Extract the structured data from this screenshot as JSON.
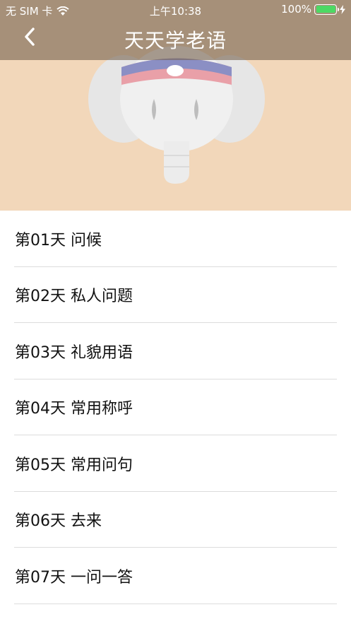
{
  "status_bar": {
    "carrier": "无 SIM 卡",
    "time": "上午10:38",
    "battery_percent": "100%",
    "battery_color": "#4cd964"
  },
  "nav": {
    "title": "天天学老语",
    "back_icon": "chevron-left-icon"
  },
  "hero": {
    "background_color": "#f2d7ba",
    "illustration": "elephant-icon"
  },
  "lessons": [
    {
      "label": "第01天 问候"
    },
    {
      "label": "第02天 私人问题"
    },
    {
      "label": "第03天 礼貌用语"
    },
    {
      "label": "第04天 常用称呼"
    },
    {
      "label": "第05天 常用问句"
    },
    {
      "label": "第06天 去来"
    },
    {
      "label": "第07天 一问一答"
    }
  ]
}
